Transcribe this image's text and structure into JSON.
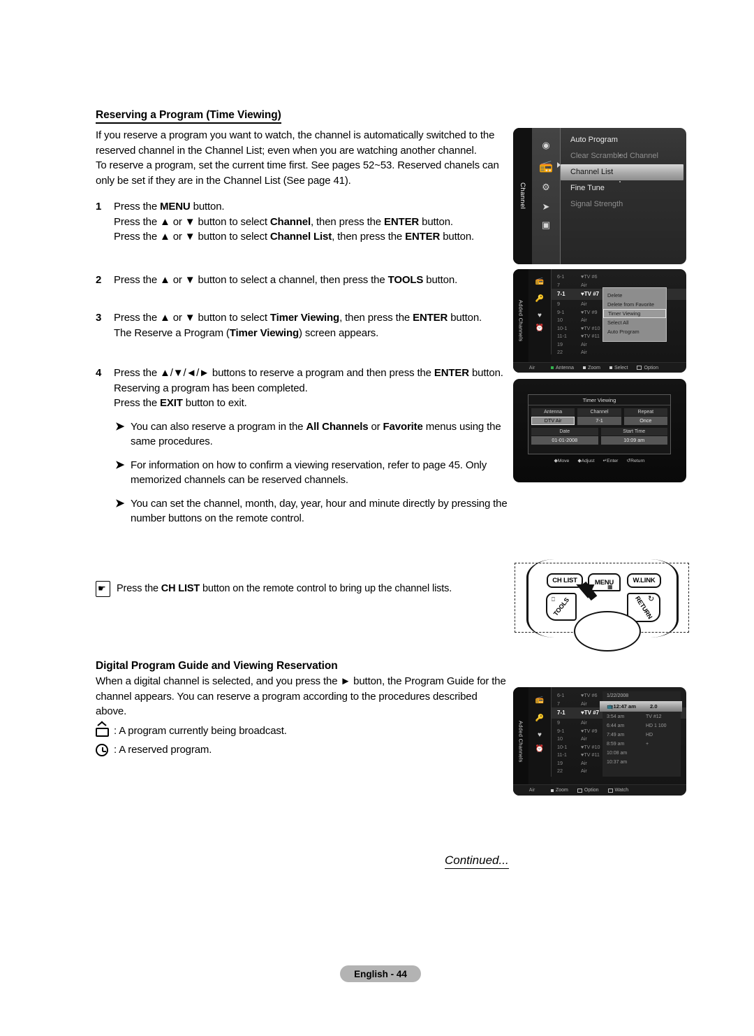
{
  "doc": {
    "page_badge": "English - 44",
    "continued": "Continued..."
  },
  "section1": {
    "title": "Reserving a Program (Time Viewing)",
    "intro1": "If you reserve a program you want to watch, the channel is automatically switched to the reserved channel in the Channel List; even when you are watching another channel.",
    "intro2": "To reserve a program, set the current time first. See pages 52~53. Reserved chanels can only be set if they are in the Channel List (See page 41).",
    "steps": [
      {
        "num": "1",
        "lines": [
          "Press the MENU button.",
          "Press the ▲ or ▼ button to select Channel, then press the ENTER button.",
          "Press the ▲ or ▼ button to select Channel List, then press the ENTER button."
        ]
      },
      {
        "num": "2",
        "lines": [
          "Press the ▲ or ▼ button to select a channel, then press the TOOLS button."
        ]
      },
      {
        "num": "3",
        "lines": [
          "Press the ▲ or ▼ button to select Timer Viewing, then press the ENTER button.",
          "The Reserve a Program (Timer Viewing) screen appears."
        ]
      },
      {
        "num": "4",
        "lines": [
          "Press the ▲/▼/◄/► buttons to reserve a program and then press the ENTER button.",
          "Reserving a program has been completed.",
          "Press the EXIT button to exit."
        ]
      }
    ],
    "notes": [
      "You can also reserve a program in the All Channels or Favorite menus using the same procedures.",
      "For information on how to confirm a viewing reservation, refer to page 45. Only memorized channels can be reserved channels.",
      "You can set the channel, month, day, year, hour and minute directly by pressing the number buttons on the remote control."
    ],
    "tip": "Press the CH LIST button on the remote control to bring up the channel lists."
  },
  "section2": {
    "title": "Digital Program Guide and Viewing Reservation",
    "body": "When a digital channel is selected, and you press the ► button, the Program Guide for the channel appears. You can reserve a program according to the procedures described above.",
    "legend": [
      {
        "icon": "tv-icon",
        "text": ": A program currently being broadcast."
      },
      {
        "icon": "clock-icon",
        "text": ": A reserved program."
      }
    ]
  },
  "shot_menu": {
    "rail_label": "Channel",
    "icons": [
      "picture-icon",
      "channel-icon",
      "setup-icon",
      "input-icon",
      "support-icon"
    ],
    "items": [
      {
        "label": "Auto Program",
        "state": "normal"
      },
      {
        "label": "Clear Scrambled Channel",
        "state": "dim"
      },
      {
        "label": "Channel List",
        "state": "active"
      },
      {
        "label": "Fine Tune",
        "state": "normal"
      },
      {
        "label": "Signal Strength",
        "state": "dim"
      }
    ]
  },
  "shot_list": {
    "rail_label": "Added Channels",
    "icons": [
      "antenna-icon",
      "added-channels-icon",
      "favorite-icon",
      "programmed-icon"
    ],
    "rows": [
      {
        "num": "6-1",
        "name": "♥TV #6",
        "hl": false
      },
      {
        "num": "7",
        "name": "Air",
        "hl": false
      },
      {
        "num": "7-1",
        "name": "♥TV #7",
        "hl": true
      },
      {
        "num": "9",
        "name": "Air",
        "hl": false
      },
      {
        "num": "9-1",
        "name": "♥TV #9",
        "hl": false
      },
      {
        "num": "10",
        "name": "Air",
        "hl": false
      },
      {
        "num": "10-1",
        "name": "♥TV #10",
        "hl": false
      },
      {
        "num": "11-1",
        "name": "♥TV #11",
        "hl": false
      },
      {
        "num": "19",
        "name": "Air",
        "hl": false
      },
      {
        "num": "22",
        "name": "Air",
        "hl": false
      }
    ],
    "tools": [
      {
        "label": "Delete",
        "sel": false
      },
      {
        "label": "Delete from Favorite",
        "sel": false
      },
      {
        "label": "Timer Viewing",
        "sel": true
      },
      {
        "label": "Select All",
        "sel": false
      },
      {
        "label": "Auto Program",
        "sel": false
      }
    ],
    "bottom": {
      "source": "Air",
      "items": [
        {
          "label": "Antenna",
          "color": "#33b24d"
        },
        {
          "label": "Zoom",
          "color": "#cfcfcf"
        },
        {
          "label": "Select",
          "color": "#cfcfcf"
        },
        {
          "label": "Option",
          "color": "#cfcfcf"
        }
      ]
    }
  },
  "shot_timer": {
    "title": "Timer Viewing",
    "fields": [
      {
        "label": "Antenna",
        "value": "DTV Air",
        "focus": true
      },
      {
        "label": "Channel",
        "value": "7-1",
        "focus": false
      },
      {
        "label": "Repeat",
        "value": "Once",
        "focus": false
      },
      {
        "label": "Date",
        "value": "01-01-2008",
        "focus": false
      },
      {
        "label": "Start Time",
        "value": "10:09 am",
        "focus": false
      }
    ],
    "footer": [
      "Move",
      "Adjust",
      "Enter",
      "Return"
    ]
  },
  "shot_remote": {
    "buttons": [
      {
        "id": "ch-list-button",
        "label": "CH LIST"
      },
      {
        "id": "menu-button",
        "label": "MENU"
      },
      {
        "id": "wlink-button",
        "label": "W.LINK"
      },
      {
        "id": "tools-button",
        "label": "TOOLS"
      },
      {
        "id": "return-button",
        "label": "RETURN"
      }
    ]
  },
  "shot_guide": {
    "rail_label": "Added Channels",
    "rows": [
      {
        "num": "6-1",
        "name": "♥TV #6"
      },
      {
        "num": "7",
        "name": "Air"
      },
      {
        "num": "7-1",
        "name": "♥TV #7"
      },
      {
        "num": "9",
        "name": "Air"
      },
      {
        "num": "9-1",
        "name": "♥TV #9"
      },
      {
        "num": "10",
        "name": "Air"
      },
      {
        "num": "10-1",
        "name": "♥TV #10"
      },
      {
        "num": "11-1",
        "name": "♥TV #11"
      },
      {
        "num": "19",
        "name": "Air"
      },
      {
        "num": "22",
        "name": "Air"
      }
    ],
    "date": "1/22/2008",
    "programs": [
      {
        "time": "12:47 am",
        "name": "2.0",
        "hl": true
      },
      {
        "time": "3:54 am",
        "name": "TV #12",
        "hl": false
      },
      {
        "time": "6:44 am",
        "name": "HD 1 100",
        "hl": false
      },
      {
        "time": "7:49 am",
        "name": "HD",
        "hl": false
      },
      {
        "time": "8:59 am",
        "name": "+",
        "hl": false
      },
      {
        "time": "10:08 am",
        "name": "",
        "hl": false
      },
      {
        "time": "10:37 am",
        "name": "",
        "hl": false
      }
    ],
    "bottom": {
      "source": "Air",
      "items": [
        {
          "label": "Zoom"
        },
        {
          "label": "Option"
        },
        {
          "label": "Watch"
        }
      ]
    }
  }
}
